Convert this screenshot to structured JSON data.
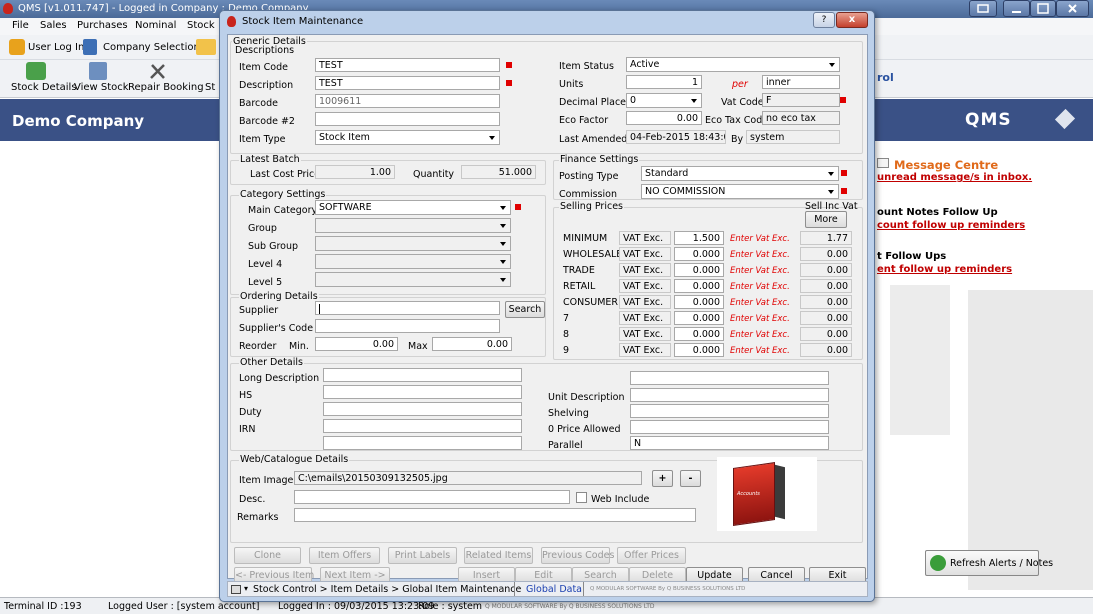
{
  "app": {
    "title": "QMS  [v1.011.747]  -  Logged in Company : Demo Company",
    "menu": [
      "File",
      "Sales",
      "Purchases",
      "Nominal",
      "Stock"
    ],
    "toolbar_top": {
      "user_login": "User Log In",
      "company_selection": "Company Selection"
    },
    "toolbar_main": [
      "Stock Details",
      "View Stock",
      "Repair Booking",
      "St"
    ],
    "rol_fragment": "rol",
    "company": "Demo Company",
    "brand_logo": "QMS",
    "alerts": {
      "message_centre": "Message Centre",
      "unread": "unread message/s in inbox.",
      "credit_notes": "ount Notes Follow Up",
      "credit_reminders": "count follow up reminders",
      "follow_ups": "t Follow Ups",
      "follow_reminders": "ent follow up reminders",
      "refresh_button": "Refresh Alerts / Notes"
    },
    "status": {
      "terminal": "Terminal ID :193",
      "user": "Logged User : [system account]",
      "logged_in": "Logged In : 09/03/2015 13:23:09",
      "role": "Role : system",
      "vendor": "Q MODULAR SOFTWARE By Q BUSINESS SOLUTIONS LTD"
    }
  },
  "dialog": {
    "title": "Stock Item Maintenance",
    "help": "?",
    "close": "x",
    "generic": {
      "group_label": "Generic Details",
      "descriptions_label": "Descriptions",
      "item_code_label": "Item Code",
      "item_code": "TEST",
      "description_label": "Description",
      "description": "TEST",
      "barcode_label": "Barcode",
      "barcode": "1009611",
      "barcode2_label": "Barcode #2",
      "barcode2": "",
      "item_type_label": "Item Type",
      "item_type": "Stock Item",
      "item_status_label": "Item Status",
      "item_status": "Active",
      "units_label": "Units",
      "units": "1",
      "per_label": "per",
      "per_value": "inner",
      "decimal_places_label": "Decimal Places",
      "decimal_places": "0",
      "vat_code_label": "Vat Code",
      "vat_code": "F",
      "eco_factor_label": "Eco Factor",
      "eco_factor": "0.00",
      "eco_tax_label": "Eco Tax Code",
      "eco_tax": "no eco tax",
      "last_amended_label": "Last Amended",
      "last_amended": "04-Feb-2015 18:43:08",
      "by_label": "By",
      "by_value": "system"
    },
    "latest_batch": {
      "label": "Latest Batch",
      "last_cost_label": "Last Cost Price",
      "last_cost": "1.00",
      "quantity_label": "Quantity",
      "quantity": "51.000"
    },
    "finance": {
      "label": "Finance Settings",
      "posting_type_label": "Posting Type",
      "posting_type": "Standard",
      "commission_label": "Commission",
      "commission": "NO COMMISSION"
    },
    "category": {
      "label": "Category Settings",
      "main_label": "Main Category",
      "main": "SOFTWARE",
      "group_label": "Group",
      "sub_group_label": "Sub Group",
      "level4_label": "Level 4",
      "level5_label": "Level 5"
    },
    "selling": {
      "label": "Selling Prices",
      "inc_vat_label": "Sell Inc Vat",
      "more_button": "More",
      "rows": [
        {
          "name": "MINIMUM",
          "vat": "VAT Exc.",
          "price": "1.500",
          "note": "Enter Vat Exc.",
          "inc": "1.77"
        },
        {
          "name": "WHOLESALE",
          "vat": "VAT Exc.",
          "price": "0.000",
          "note": "Enter Vat Exc.",
          "inc": "0.00"
        },
        {
          "name": "TRADE",
          "vat": "VAT Exc.",
          "price": "0.000",
          "note": "Enter Vat Exc.",
          "inc": "0.00"
        },
        {
          "name": "RETAIL",
          "vat": "VAT Exc.",
          "price": "0.000",
          "note": "Enter Vat Exc.",
          "inc": "0.00"
        },
        {
          "name": "CONSUMER",
          "vat": "VAT Exc.",
          "price": "0.000",
          "note": "Enter Vat Exc.",
          "inc": "0.00"
        },
        {
          "name": "7",
          "vat": "VAT Exc.",
          "price": "0.000",
          "note": "Enter Vat Exc.",
          "inc": "0.00"
        },
        {
          "name": "8",
          "vat": "VAT Exc.",
          "price": "0.000",
          "note": "Enter Vat Exc.",
          "inc": "0.00"
        },
        {
          "name": "9",
          "vat": "VAT Exc.",
          "price": "0.000",
          "note": "Enter Vat Exc.",
          "inc": "0.00"
        }
      ]
    },
    "ordering": {
      "label": "Ordering Details",
      "supplier_label": "Supplier",
      "supplier": "",
      "search_button": "Search",
      "suppliers_code_label": "Supplier's Code",
      "reorder_label": "Reorder",
      "min_label": "Min.",
      "min": "0.00",
      "max_label": "Max",
      "max": "0.00"
    },
    "other": {
      "label": "Other Details",
      "long_desc_label": "Long Description",
      "hs_label": "HS",
      "duty_label": "Duty",
      "irn_label": "IRN",
      "unit_desc_label": "Unit Description",
      "shelving_label": "Shelving",
      "zero_price_label": "0 Price Allowed",
      "parallel_label": "Parallel",
      "parallel": "N"
    },
    "web": {
      "label": "Web/Catalogue Details",
      "item_image_label": "Item Image",
      "item_image": "C:\\emails\\20150309132505.jpg",
      "plus": "+",
      "minus": "-",
      "desc_label": "Desc.",
      "web_include_label": "Web Include",
      "remarks_label": "Remarks",
      "box_text": "Accounts"
    },
    "buttons_row1": [
      "Clone",
      "Item Offers",
      "Print Labels",
      "Related Items",
      "Previous Codes",
      "Offer Prices"
    ],
    "buttons_row2": {
      "prev": "<- Previous Item",
      "next": "Next Item ->",
      "insert": "Insert",
      "edit": "Edit",
      "search": "Search",
      "delete": "Delete",
      "update": "Update",
      "cancel": "Cancel",
      "exit": "Exit"
    },
    "statusbar": {
      "path": "Stock Control > Item Details > Global Item Maintenance",
      "global": "Global Data",
      "vendor": "Q MODULAR SOFTWARE By Q BUSINESS SOLUTIONS LTD"
    }
  }
}
